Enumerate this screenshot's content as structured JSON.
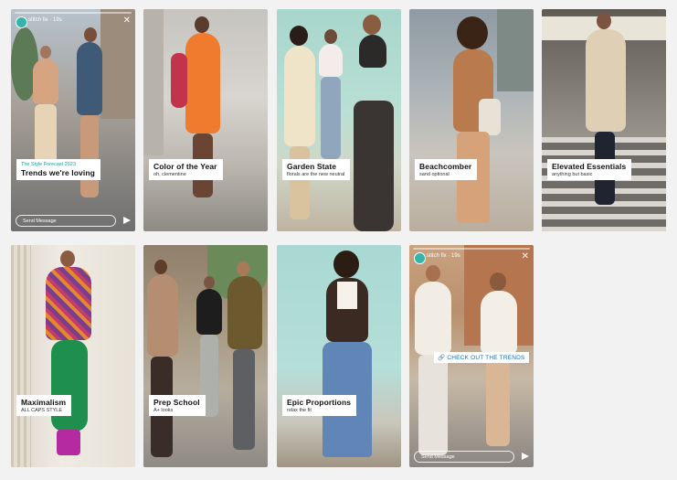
{
  "stories": [
    {
      "title": "Trends we're loving",
      "kicker": "The Style Forecast 2023",
      "brand": "stitch fix",
      "time": "19s",
      "message_placeholder": "Send Message"
    },
    {
      "title": "Color of the Year",
      "subtitle": "oh, clementine"
    },
    {
      "title": "Garden State",
      "subtitle": "florals are the new neutral"
    },
    {
      "title": "Beachcomber",
      "subtitle": "sand optional"
    },
    {
      "title": "Elevated Essentials",
      "subtitle": "anything but basic"
    },
    {
      "title": "Maximalism",
      "subtitle": "ALL CAPS STYLE"
    },
    {
      "title": "Prep School",
      "subtitle": "A+ looks"
    },
    {
      "title": "Epic Proportions",
      "subtitle": "relax the fit"
    },
    {
      "brand": "stitch fix",
      "time": "19s",
      "cta": "CHECK OUT THE TRENDS",
      "message_placeholder": "Send Message"
    }
  ],
  "icons": {
    "close": "close-icon",
    "send": "send-icon",
    "link": "link-icon",
    "avatar": "stitch-fix-logo"
  },
  "colors": {
    "brand_teal": "#35b3ad",
    "cta_blue": "#1a6fb3"
  }
}
